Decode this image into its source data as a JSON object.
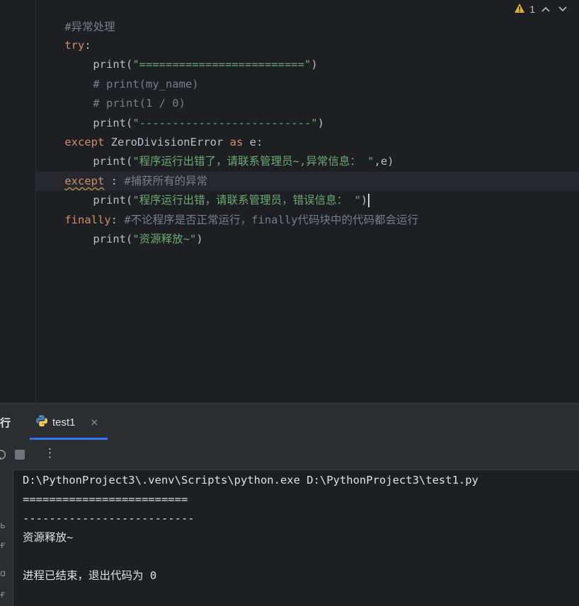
{
  "editor": {
    "lines": [
      {
        "comment": "#异常处理"
      },
      {
        "kw": "try",
        "punct": ":"
      },
      {
        "fn": "print",
        "open": "(",
        "str": "\"=========================\"",
        "close": ")"
      },
      {
        "comment": "# print(my_name)"
      },
      {
        "comment": "# print(1 / 0)"
      },
      {
        "fn": "print",
        "open": "(",
        "str": "\"--------------------------\"",
        "close": ")"
      },
      {
        "kw": "except",
        "cls": " ZeroDivisionError ",
        "kw2": "as",
        "rest": " e:"
      },
      {
        "fn": "print",
        "open": "(",
        "str": "\"程序运行出错了，请联系管理员~,异常信息： \"",
        "rest": ",e)"
      },
      {
        "kw": "except",
        "rest": " : ",
        "comment": "#捕获所有的异常"
      },
      {
        "fn": "print",
        "open": "(",
        "str": "\"程序运行出错，请联系管理员，错误信息： \"",
        "close": ")"
      },
      {
        "kw": "finally",
        "punct": ": ",
        "comment": "#不论程序是否正常运行，finally代码块中的代码都会运行"
      },
      {
        "fn": "print",
        "open": "(",
        "str": "\"资源释放~\"",
        "close": ")"
      }
    ],
    "inspection": {
      "warning_count": "1",
      "warning_icon": "warning-triangle-icon"
    }
  },
  "run_window": {
    "title": "行",
    "tab": {
      "label": "test1",
      "icon": "python-icon",
      "close": "×"
    },
    "toolbar": {
      "more": "⋮"
    },
    "left_strip_glyphs": [
      "ь",
      "ғ",
      "ɑ",
      "ғ"
    ],
    "console_lines": [
      "D:\\PythonProject3\\.venv\\Scripts\\python.exe D:\\PythonProject3\\test1.py",
      "=========================",
      "--------------------------",
      "资源释放~",
      "",
      "进程已结束，退出代码为 0"
    ]
  },
  "colors": {
    "background": "#1e1f22",
    "keyword": "#cf8e6d",
    "string": "#6aab73",
    "comment": "#7a7e85",
    "text": "#bcbec4",
    "accent": "#3574f0",
    "warning": "#e0b036"
  }
}
